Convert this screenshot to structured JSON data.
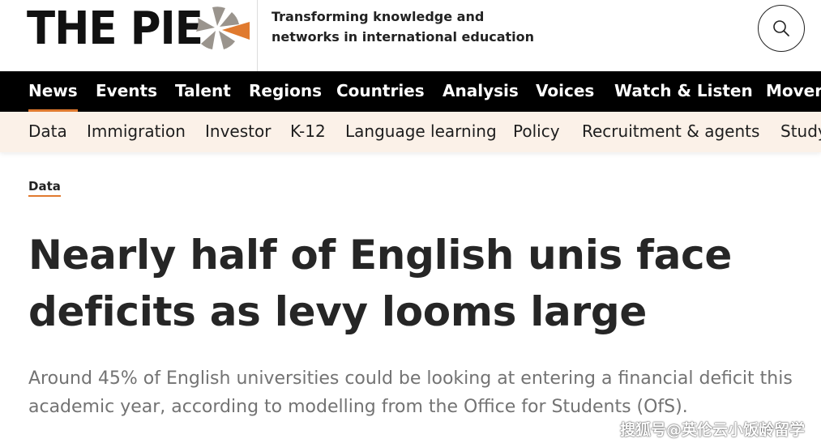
{
  "brand": {
    "logo_text": "THE PIE",
    "tagline": "Transforming knowledge and networks in international education",
    "accent_color": "#e07a2f"
  },
  "search": {
    "icon": "search-icon"
  },
  "nav_primary": {
    "items": [
      {
        "label": "News",
        "active": true
      },
      {
        "label": "Events"
      },
      {
        "label": "Talent"
      },
      {
        "label": "Regions"
      },
      {
        "label": "Countries"
      },
      {
        "label": "Analysis"
      },
      {
        "label": "Voices"
      },
      {
        "label": "Watch & Listen"
      },
      {
        "label": "Movers"
      }
    ]
  },
  "nav_secondary": {
    "items": [
      {
        "label": "Data"
      },
      {
        "label": "Immigration"
      },
      {
        "label": "Investor"
      },
      {
        "label": "K-12"
      },
      {
        "label": "Language learning"
      },
      {
        "label": "Policy"
      },
      {
        "label": "Recruitment & agents"
      },
      {
        "label": "Study"
      }
    ]
  },
  "article": {
    "category": "Data",
    "headline": "Nearly half of English unis face deficits as levy looms large",
    "standfirst": "Around 45% of English universities could be looking at entering a financial deficit this academic year, according to modelling from the Office for Students (OfS)."
  },
  "watermark": "搜狐号@英伦云小饭龄留学"
}
